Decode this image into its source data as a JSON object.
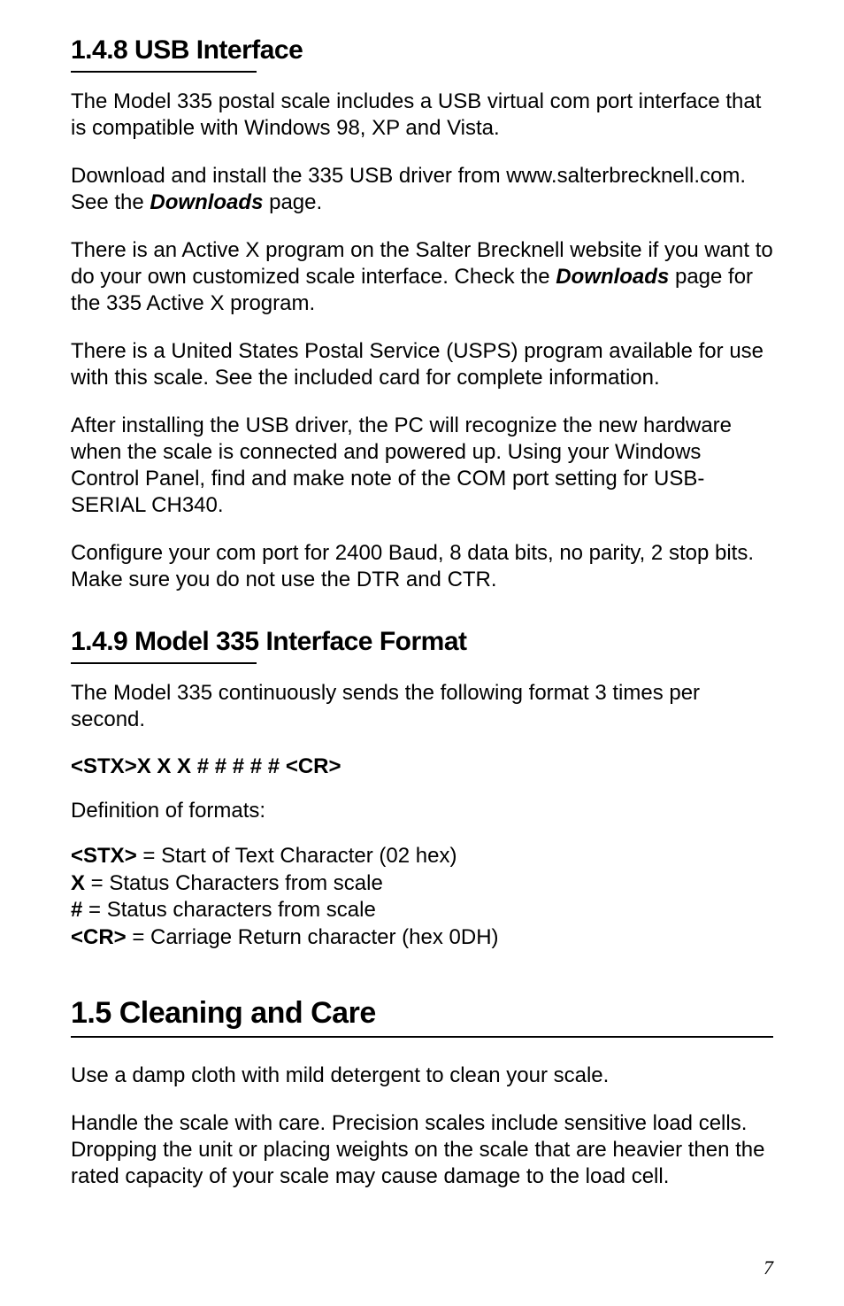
{
  "section_1_4_8": {
    "heading": "1.4.8   USB Interface",
    "p1": "The Model 335 postal scale includes a USB virtual com port interface that is compatible with Windows 98, XP and Vista.",
    "p2_a": "Download and install the 335 USB driver from www.salterbrecknell.com. See the ",
    "p2_b": "Downloads",
    "p2_c": " page.",
    "p3_a": "There is an Active X program on the Salter Brecknell website if you want to do your own customized scale interface. Check the ",
    "p3_b": "Downloads",
    "p3_c": " page for the 335 Active X program.",
    "p4": "There is a United States Postal Service (USPS) program available for use with this scale. See the included card for complete information.",
    "p5": "After installing the USB driver, the PC will recognize the new hardware when the scale is connected and powered up. Using your Windows Control Panel, find and make note of the COM port setting for USB-SERIAL CH340.",
    "p6": "Configure your com port for 2400 Baud, 8 data bits, no parity, 2 stop bits. Make sure you do not use the DTR and CTR."
  },
  "section_1_4_9": {
    "heading": "1.4.9   Model 335 Interface Format",
    "p1": "The Model 335 continuously sends the following format 3 times per second.",
    "format": "<STX>X X X # # # # # <CR>",
    "def_label": "Definition of formats:",
    "defs": {
      "stx_k": "<STX>",
      "stx_v": " = Start of Text Character (02 hex)",
      "x_k": "X",
      "x_v": " = Status Characters from scale",
      "hash_k": "#",
      "hash_v": " = Status characters from scale",
      "cr_k": "<CR>",
      "cr_v": " = Carriage Return character (hex 0DH)"
    }
  },
  "section_1_5": {
    "heading": "1.5   Cleaning and Care",
    "p1": "Use a damp cloth with mild detergent to clean your scale.",
    "p2": "Handle the scale with care. Precision scales include sensitive load cells. Dropping the unit or placing weights on the scale that are heavier then the rated capacity of your scale may cause damage to the load cell."
  },
  "page_number": "7"
}
